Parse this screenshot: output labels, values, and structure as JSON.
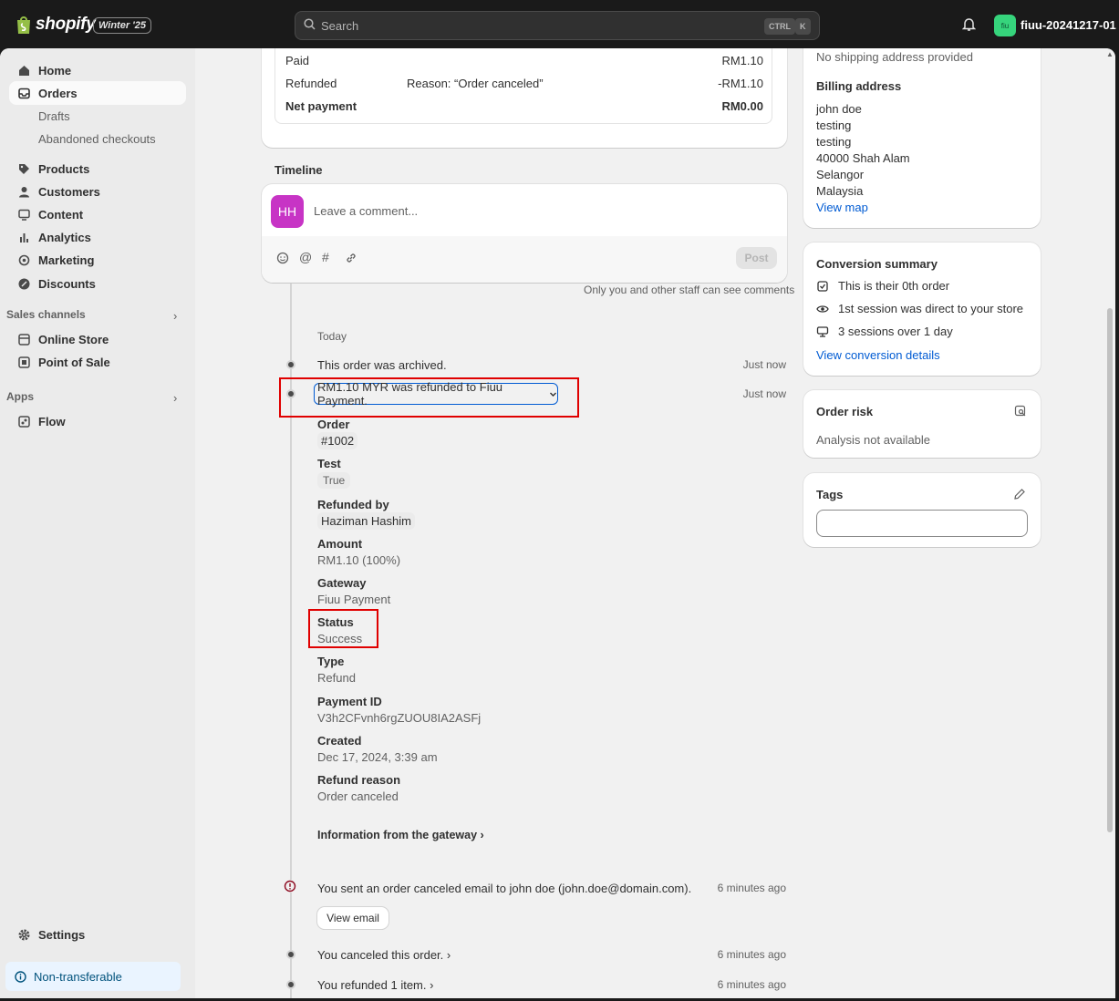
{
  "topbar": {
    "logo_text": "shopify",
    "edition_badge": "Winter '25",
    "search_placeholder": "Search",
    "kbd_ctrl": "CTRL",
    "kbd_k": "K",
    "store_avatar": "fiu",
    "store_name": "fiuu-20241217-01"
  },
  "sidebar": {
    "home": "Home",
    "orders": "Orders",
    "drafts": "Drafts",
    "abandoned": "Abandoned checkouts",
    "products": "Products",
    "customers": "Customers",
    "content": "Content",
    "analytics": "Analytics",
    "marketing": "Marketing",
    "discounts": "Discounts",
    "sales_channels": "Sales channels",
    "online_store": "Online Store",
    "pos": "Point of Sale",
    "apps": "Apps",
    "flow": "Flow",
    "settings": "Settings",
    "non_transferable": "Non-transferable"
  },
  "payment": {
    "paid_label": "Paid",
    "paid_value": "RM1.10",
    "refunded_label": "Refunded",
    "refunded_reason": "Reason: “Order canceled”",
    "refunded_value": "-RM1.10",
    "net_label": "Net payment",
    "net_value": "RM0.00"
  },
  "timeline": {
    "title": "Timeline",
    "avatar_initials": "HH",
    "comment_placeholder": "Leave a comment...",
    "post_label": "Post",
    "staff_note": "Only you and other staff can see comments",
    "today": "Today",
    "events": {
      "archived": {
        "text": "This order was archived.",
        "time": "Just now"
      },
      "refunded": {
        "text": "RM1.10 MYR was refunded to Fiuu Payment.",
        "time": "Just now"
      },
      "email": {
        "text": "You sent an order canceled email to john doe (john.doe@domain.com).",
        "time": "6 minutes ago",
        "button": "View email"
      },
      "canceled": {
        "text": "You canceled this order.",
        "time": "6 minutes ago"
      },
      "refunded_item": {
        "text": "You refunded 1 item.",
        "time": "6 minutes ago"
      }
    },
    "details": {
      "order_label": "Order",
      "order_value": "#1002",
      "test_label": "Test",
      "test_value": "True",
      "refunded_by_label": "Refunded by",
      "refunded_by_value": "Haziman Hashim",
      "amount_label": "Amount",
      "amount_value": "RM1.10 (100%)",
      "gateway_label": "Gateway",
      "gateway_value": "Fiuu Payment",
      "status_label": "Status",
      "status_value": "Success",
      "type_label": "Type",
      "type_value": "Refund",
      "payment_id_label": "Payment ID",
      "payment_id_value": "V3h2CFvnh6rgZUOU8IA2ASFj",
      "created_label": "Created",
      "created_value": "Dec 17, 2024, 3:39 am",
      "refund_reason_label": "Refund reason",
      "refund_reason_value": "Order canceled",
      "gateway_info": "Information from the gateway"
    }
  },
  "customer": {
    "no_shipping": "No shipping address provided",
    "billing_title": "Billing address",
    "billing_lines": [
      "john doe",
      "testing",
      "testing",
      "40000 Shah Alam",
      "Selangor",
      "Malaysia"
    ],
    "view_map": "View map"
  },
  "conversion": {
    "title": "Conversion summary",
    "row1": "This is their 0th order",
    "row2": "1st session was direct to your store",
    "row3": "3 sessions over 1 day",
    "link": "View conversion details"
  },
  "risk": {
    "title": "Order risk",
    "text": "Analysis not available"
  },
  "tags": {
    "title": "Tags",
    "value": ""
  },
  "colors": {
    "highlight_box": "#e00000",
    "link": "#005bd3",
    "avatar": "#c734c5",
    "store_avatar": "#36d47c"
  }
}
